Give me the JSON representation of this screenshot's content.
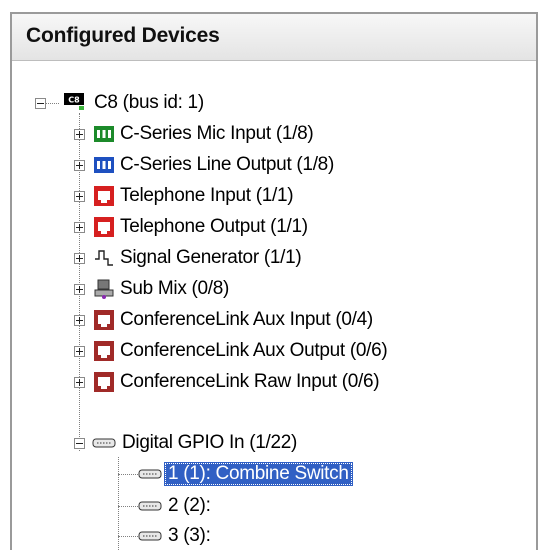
{
  "panel": {
    "title": "Configured Devices"
  },
  "tree": {
    "root": {
      "badge": "C8",
      "label": "C8 (bus id: 1)",
      "expanded": true
    },
    "children": [
      {
        "label": "C-Series Mic Input (1/8)",
        "icon": "mic-input-icon",
        "expanded": false
      },
      {
        "label": "C-Series Line Output (1/8)",
        "icon": "line-output-icon",
        "expanded": false
      },
      {
        "label": "Telephone Input (1/1)",
        "icon": "telephone-input-icon",
        "expanded": false
      },
      {
        "label": "Telephone Output (1/1)",
        "icon": "telephone-output-icon",
        "expanded": false
      },
      {
        "label": "Signal Generator (1/1)",
        "icon": "signal-generator-icon",
        "expanded": false
      },
      {
        "label": "Sub Mix (0/8)",
        "icon": "sub-mix-icon",
        "expanded": false
      },
      {
        "label": "ConferenceLink Aux Input (0/4)",
        "icon": "conferencelink-icon",
        "expanded": false
      },
      {
        "label": "ConferenceLink Aux Output (0/6)",
        "icon": "conferencelink-icon",
        "expanded": false
      },
      {
        "label": "ConferenceLink Raw Input (0/6)",
        "icon": "conferencelink-icon",
        "expanded": false
      },
      {
        "label": "Digital GPIO In (1/22)",
        "icon": "gpio-connector-icon",
        "expanded": true
      }
    ],
    "gpio_children": [
      {
        "label": "1 (1): Combine Switch",
        "icon": "gpio-connector-icon",
        "selected": true
      },
      {
        "label": "2 (2):",
        "icon": "gpio-connector-icon",
        "selected": false
      },
      {
        "label": "3 (3):",
        "icon": "gpio-connector-icon",
        "selected": false
      }
    ]
  },
  "colors": {
    "selection": "#3160c4",
    "mic_icon": "#1c8a2a",
    "output_icon": "#1e50c0",
    "telephone_icon": "#d62020",
    "conferencelink_icon": "#a02a28"
  }
}
